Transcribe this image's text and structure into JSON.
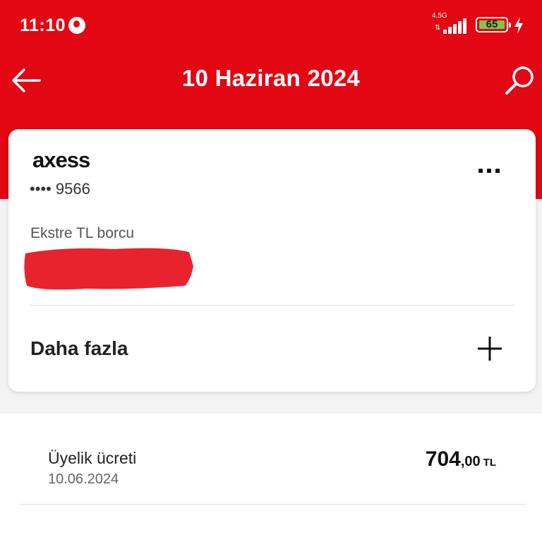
{
  "status_bar": {
    "time": "11:10",
    "network_type": "4.5G",
    "battery_level": "65",
    "icons": [
      "app-notification-icon",
      "signal-icon",
      "battery-icon",
      "charging-icon"
    ]
  },
  "header": {
    "title": "10 Haziran 2024",
    "back_icon": "arrow-left-icon",
    "search_icon": "search-icon"
  },
  "card": {
    "brand": "axess",
    "masked_number": "•••• 9566",
    "debt_label": "Ekstre TL borcu",
    "more_menu_icon": "more-horizontal-icon",
    "expand_label": "Daha fazla",
    "expand_icon": "plus-icon"
  },
  "transactions": [
    {
      "title": "Üyelik ücreti",
      "date": "10.06.2024",
      "amount_main": "704",
      "amount_decimal": ",00",
      "currency": "TL"
    }
  ],
  "colors": {
    "brand_red": "#e30613",
    "redaction_red": "#e8232f",
    "background_gray": "#f3f3f3",
    "battery_green": "#7ec64a"
  }
}
